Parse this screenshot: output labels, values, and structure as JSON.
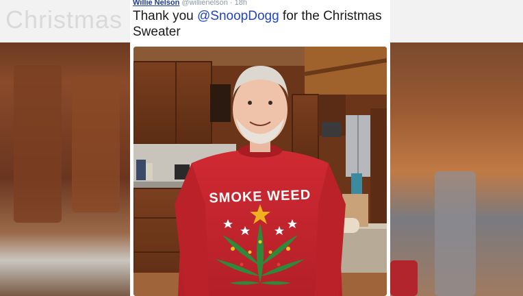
{
  "background": {
    "ghost_title": "Christmas"
  },
  "tweet": {
    "author_name": "Willie Nelson",
    "handle": "@willienelson",
    "separator": "·",
    "time": "18h",
    "text_before": "Thank you ",
    "mention": "@SnoopDogg",
    "text_after": " for the Christmas Sweater"
  },
  "photo": {
    "sweater_line1": "SMOKE WEED",
    "icon": "cannabis-leaf-icon"
  },
  "colors": {
    "mention": "#1f44c7",
    "author": "#1b3b8f",
    "sweater": "#c8232c"
  }
}
